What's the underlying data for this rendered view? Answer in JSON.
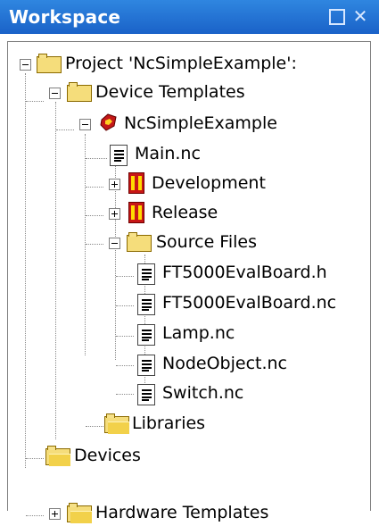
{
  "window": {
    "title": "Workspace",
    "controls": {
      "maximize_icon": "restore-square",
      "close_icon": "close-x"
    }
  },
  "tree": {
    "items": [
      {
        "label": "Project 'NcSimpleExample':",
        "icon": "project-folder-icon",
        "expanded": true
      },
      {
        "label": "Device Templates",
        "icon": "open-folder-icon",
        "expanded": true
      },
      {
        "label": "NcSimpleExample",
        "icon": "device-template-icon",
        "expanded": true
      },
      {
        "label": "Main.nc",
        "icon": "document-icon"
      },
      {
        "label": "Development",
        "icon": "build-config-icon",
        "expanded": false
      },
      {
        "label": "Release",
        "icon": "build-config-icon",
        "expanded": false
      },
      {
        "label": "Source Files",
        "icon": "open-folder-icon",
        "expanded": true
      },
      {
        "label": "FT5000EvalBoard.h",
        "icon": "document-icon"
      },
      {
        "label": "FT5000EvalBoard.nc",
        "icon": "document-icon"
      },
      {
        "label": "Lamp.nc",
        "icon": "document-icon"
      },
      {
        "label": "NodeObject.nc",
        "icon": "document-icon"
      },
      {
        "label": "Switch.nc",
        "icon": "document-icon"
      },
      {
        "label": "Libraries",
        "icon": "folder-icon"
      },
      {
        "label": "Devices",
        "icon": "folder-icon"
      },
      {
        "label": "Hardware Templates",
        "icon": "folder-icon",
        "expanded": false
      }
    ]
  },
  "colors": {
    "titlebar": "#1a62c8",
    "folder": "#f5dd7b",
    "selection_text": "#000000"
  }
}
